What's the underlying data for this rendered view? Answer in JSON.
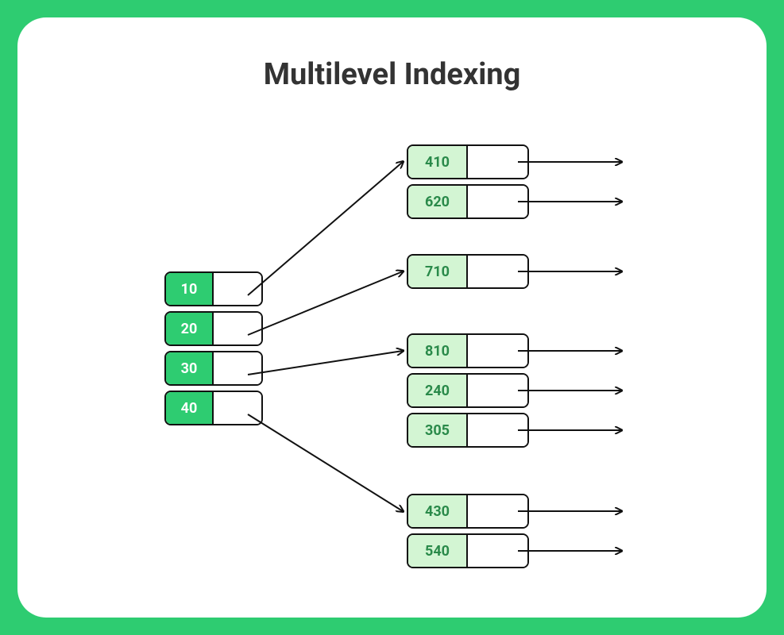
{
  "title": "Multilevel Indexing",
  "colors": {
    "frame": "#2ecc71",
    "primary_key_bg": "#2ecc71",
    "primary_key_fg": "#ffffff",
    "secondary_key_bg": "#d3f5d3",
    "secondary_key_fg": "#2a8a4a"
  },
  "primary_index": [
    {
      "key": "10"
    },
    {
      "key": "20"
    },
    {
      "key": "30"
    },
    {
      "key": "40"
    }
  ],
  "secondary_blocks": [
    {
      "rows": [
        {
          "key": "410"
        },
        {
          "key": "620"
        }
      ]
    },
    {
      "rows": [
        {
          "key": "710"
        }
      ]
    },
    {
      "rows": [
        {
          "key": "810"
        },
        {
          "key": "240"
        },
        {
          "key": "305"
        }
      ]
    },
    {
      "rows": [
        {
          "key": "430"
        },
        {
          "key": "540"
        }
      ]
    }
  ]
}
